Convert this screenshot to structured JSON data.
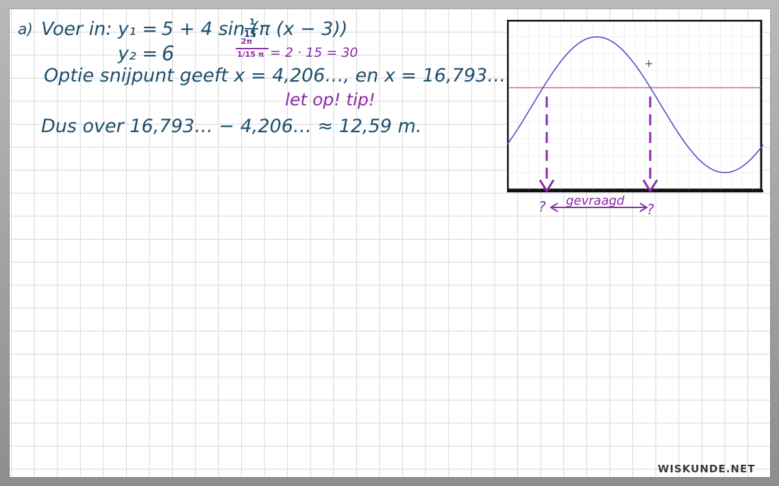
{
  "work": {
    "line1_label": "a)",
    "line1_text": "Voer in:",
    "line1_y1": "y₁ =",
    "line1_expr": "5 + 4 sin (",
    "line1_frac_num": "1",
    "line1_frac_den": "15",
    "line1_frac_tail": "π (x − 3))",
    "line2_y2": "y₂ =",
    "line2_value": "6",
    "period_num": "2π",
    "period_den": "1/15 π",
    "period_eq": "= 2 · 15 = 30",
    "line3": "Optie snijpunt geeft  x = 4,206…,  en   x = 16,793…",
    "tip": "let op!  tip!",
    "line4": "Dus over  16,793… − 4,206… ≈ 12,59 m.",
    "graph_label_left": "?",
    "graph_label_mid": "gevraagd",
    "graph_label_right": "?",
    "brand": "WISKUNDE.NET"
  },
  "colors": {
    "ink": "#1d4f6b",
    "annotation": "#8a2aa6",
    "curve": "#4a4ad0",
    "line": "#c06070"
  },
  "chart_data": {
    "type": "line",
    "series": [
      {
        "formula": "5 + 4 sin(π/15 (x − 3))"
      },
      {
        "formula": "6"
      }
    ],
    "intersections_x": [
      4.206,
      16.793
    ],
    "grid": true
  }
}
